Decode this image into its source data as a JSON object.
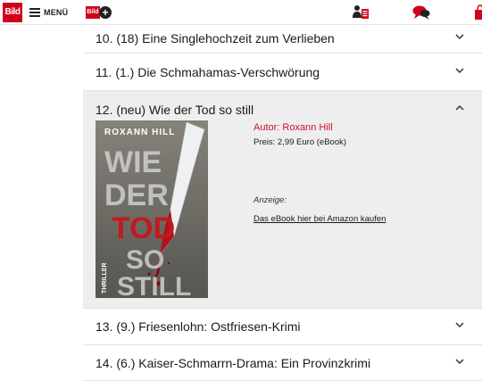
{
  "header": {
    "logo_text": "Bild",
    "menu_label": "MENÜ",
    "bildplus_logo": "Bild",
    "bildplus_plus": "+",
    "accent_color": "#d0021b"
  },
  "books": [
    {
      "title": "10. (18) Eine Singlehochzeit zum Verlieben",
      "expanded": false
    },
    {
      "title": "11. (1.) Die Schmahamas-Verschwörung",
      "expanded": false
    },
    {
      "title": "12. (neu) Wie der Tod so still",
      "expanded": true,
      "author": "Autor: Roxann Hill",
      "price": "Preis: 2,99 Euro (eBook)",
      "ad_label": "Anzeige:",
      "ad_link": "Das eBook hier bei Amazon kaufen",
      "cover": {
        "author": "ROXANN HILL",
        "word1": "WIE",
        "word2": "DER",
        "word3": "TOD",
        "word4": "SO",
        "word5": "STILL",
        "genre": "THRILLER"
      }
    },
    {
      "title": "13. (9.) Friesenlohn: Ostfriesen-Krimi",
      "expanded": false
    },
    {
      "title": "14. (6.) Kaiser-Schmarrn-Drama: Ein Provinzkrimi",
      "expanded": false
    }
  ]
}
